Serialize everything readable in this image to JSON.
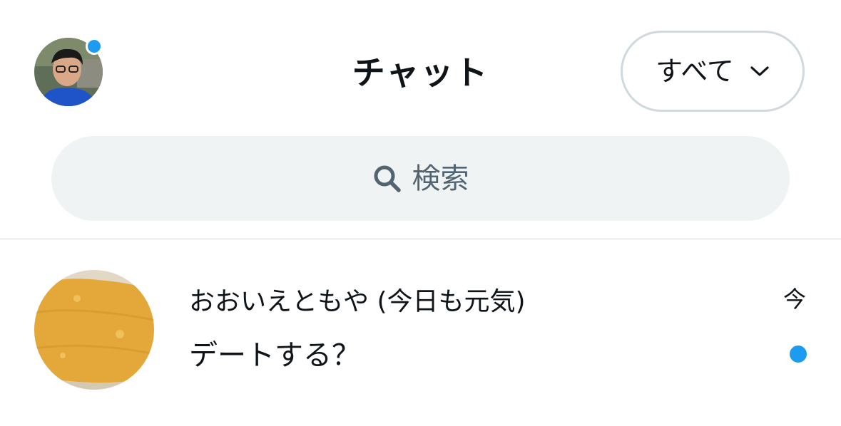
{
  "header": {
    "title": "チャット",
    "filter_label": "すべて"
  },
  "search": {
    "placeholder": "検索"
  },
  "conversations": [
    {
      "name": "おおいえともや (今日も元気)",
      "message": "デートする？",
      "time": "今",
      "unread": true
    }
  ],
  "colors": {
    "accent": "#1d9bf0",
    "search_bg": "#eff3f4",
    "border": "#cfd9de",
    "muted_text": "#536471"
  },
  "icons": {
    "filter": "chevron-down-icon",
    "search": "search-icon"
  }
}
